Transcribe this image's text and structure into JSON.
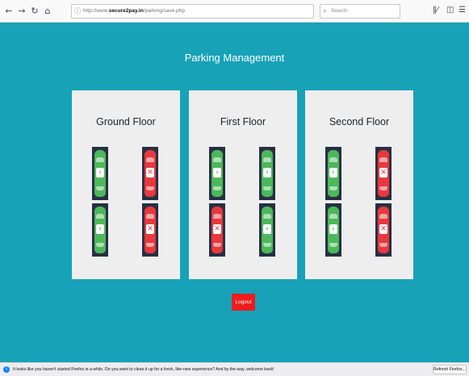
{
  "browser": {
    "url_prefix": "http://www.",
    "url_domain": "secure2pay.in",
    "url_path": "/parking/save.php",
    "search_placeholder": "Search",
    "back_icon": "back-arrow-icon",
    "forward_icon": "forward-arrow-icon",
    "reload_icon": "reload-icon",
    "home_icon": "home-icon",
    "library_icon": "library-icon",
    "sidebar_icon": "sidebar-icon",
    "overflow_icon": "overflow-icon"
  },
  "page": {
    "title": "Parking Management",
    "logout_label": "Logout",
    "background_color": "#17a2b8",
    "floors": [
      {
        "name": "Ground Floor",
        "slots": [
          "free",
          "taken",
          "free",
          "taken"
        ]
      },
      {
        "name": "First Floor",
        "slots": [
          "free",
          "free",
          "taken",
          "free"
        ]
      },
      {
        "name": "Second Floor",
        "slots": [
          "free",
          "taken",
          "free",
          "taken"
        ]
      }
    ],
    "colors": {
      "free": "#4cb85a",
      "taken": "#e8383d",
      "logout": "#ee1c1c"
    }
  },
  "notification": {
    "message": "It looks like you haven't started Firefox in a while. Do you want to clean it up for a fresh, like-new experience? And by the way, welcome back!",
    "button_label": "Refresh Firefox..."
  }
}
